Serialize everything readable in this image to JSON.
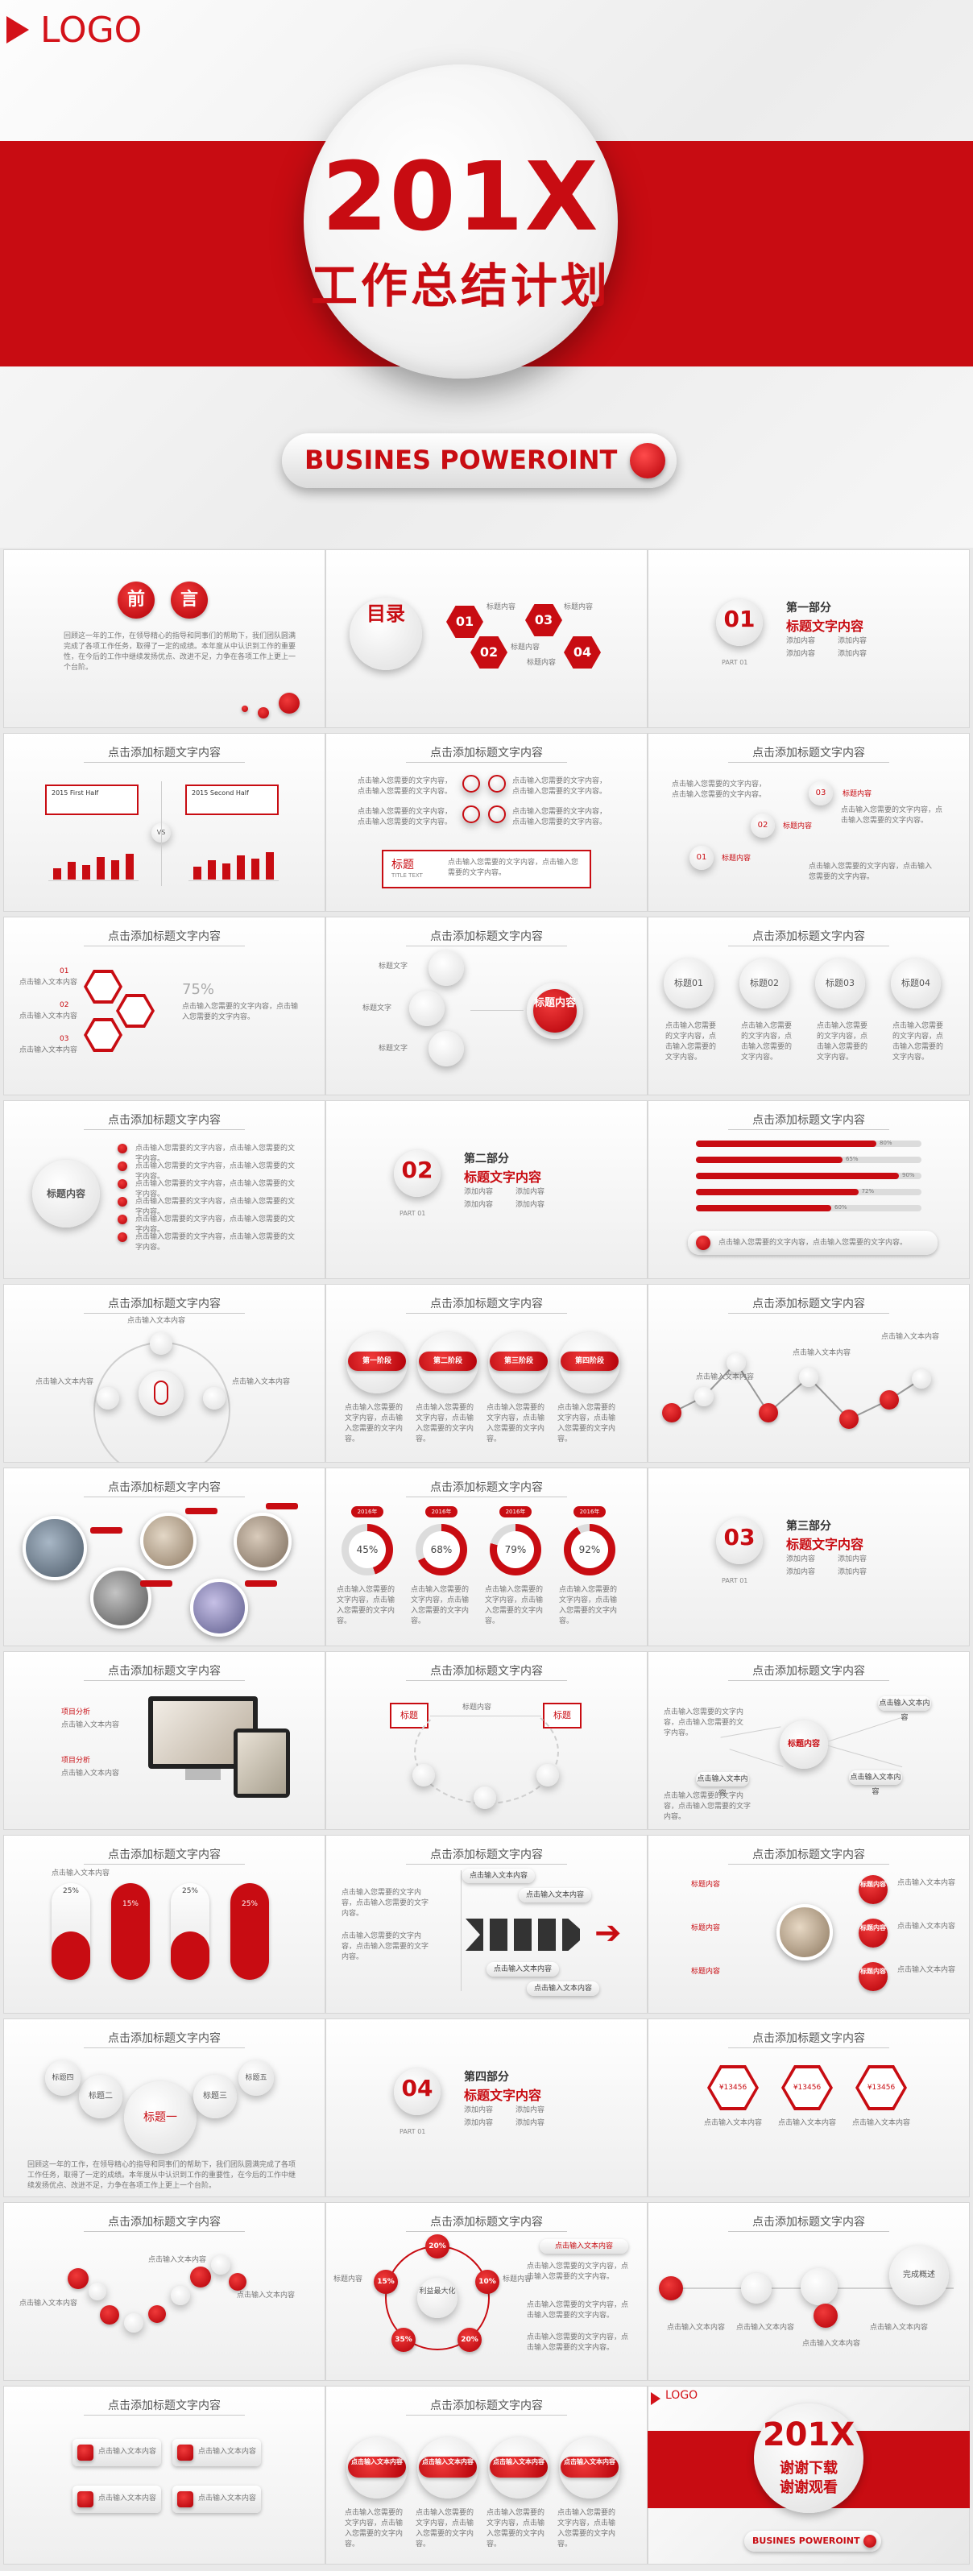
{
  "hero": {
    "logo": "LOGO",
    "year": "201X",
    "title": "工作总结计划",
    "pill": "BUSINES POWEROINT"
  },
  "common": {
    "slide_title": "点击添加标题文字内容",
    "body_short": "点击输入文本内容",
    "body_long": "点击输入您需要的文字内容，点击输入您需要的文字内容。",
    "title_text": "标题文字",
    "add_title": "添加标题",
    "title_content": "标题内容",
    "project": "项目分析"
  },
  "preface": {
    "chars": [
      "前",
      "言"
    ],
    "body": "回顾这一年的工作，在领导精心的指导和同事们的帮助下，我们团队圆满完成了各项工作任务，取得了一定的成绩。本年度从中认识到工作的重要性，在今后的工作中继续发扬优点、改进不足，力争在各项工作上更上一个台阶。"
  },
  "contents": {
    "title": "目录",
    "items": [
      "01",
      "02",
      "03",
      "04"
    ],
    "labels": [
      "标题内容",
      "标题内容",
      "标题内容",
      "标题内容"
    ]
  },
  "parts": [
    {
      "num": "01",
      "name": "第一部分",
      "title": "标题文字内容",
      "sub": "PART 01",
      "items": [
        "添加内容",
        "添加内容",
        "添加内容",
        "添加内容"
      ]
    },
    {
      "num": "02",
      "name": "第二部分",
      "title": "标题文字内容",
      "sub": "PART 01",
      "items": [
        "添加内容",
        "添加内容",
        "添加内容",
        "添加内容"
      ]
    },
    {
      "num": "03",
      "name": "第三部分",
      "title": "标题文字内容",
      "sub": "PART 01",
      "items": [
        "添加内容",
        "添加内容",
        "添加内容",
        "添加内容"
      ]
    },
    {
      "num": "04",
      "name": "第四部分",
      "title": "标题文字内容",
      "sub": "PART 01",
      "items": [
        "添加内容",
        "添加内容",
        "添加内容",
        "添加内容"
      ]
    }
  ],
  "half_year": {
    "first": "2015 First Half",
    "second": "2015 Second Half",
    "vs": "VS"
  },
  "icon_slide": {
    "label": "标题",
    "en": "TITLE TEXT"
  },
  "steps": [
    "01",
    "02",
    "03"
  ],
  "percent_label": "75%",
  "labels4": [
    "标题01",
    "标题02",
    "标题03",
    "标题04"
  ],
  "progress": {
    "values": [
      80,
      65,
      90,
      72,
      60
    ],
    "labels": [
      "80%",
      "65%",
      "90%",
      "72%",
      "60%"
    ]
  },
  "circles4": [
    "第一阶段",
    "第二阶段",
    "第三阶段",
    "第四阶段"
  ],
  "donuts": {
    "values": [
      45,
      68,
      79,
      92
    ],
    "labels": [
      "45%",
      "68%",
      "79%",
      "92%"
    ],
    "year": "2016年"
  },
  "pills_pct": [
    "25%",
    "15%",
    "25%",
    "25%"
  ],
  "bubbles": [
    "标题一",
    "标题二",
    "标题三",
    "标题四",
    "标题五"
  ],
  "prices": [
    "¥13456",
    "¥13456",
    "¥13456"
  ],
  "center_label": "利益最大化",
  "ring_pcts": [
    "20%",
    "10%",
    "20%",
    "35%",
    "15%"
  ],
  "timeline_label": "完成概述",
  "end": {
    "logo": "LOGO",
    "year": "201X",
    "line1": "谢谢下载",
    "line2": "谢谢观看",
    "pill": "BUSINES POWEROINT"
  }
}
